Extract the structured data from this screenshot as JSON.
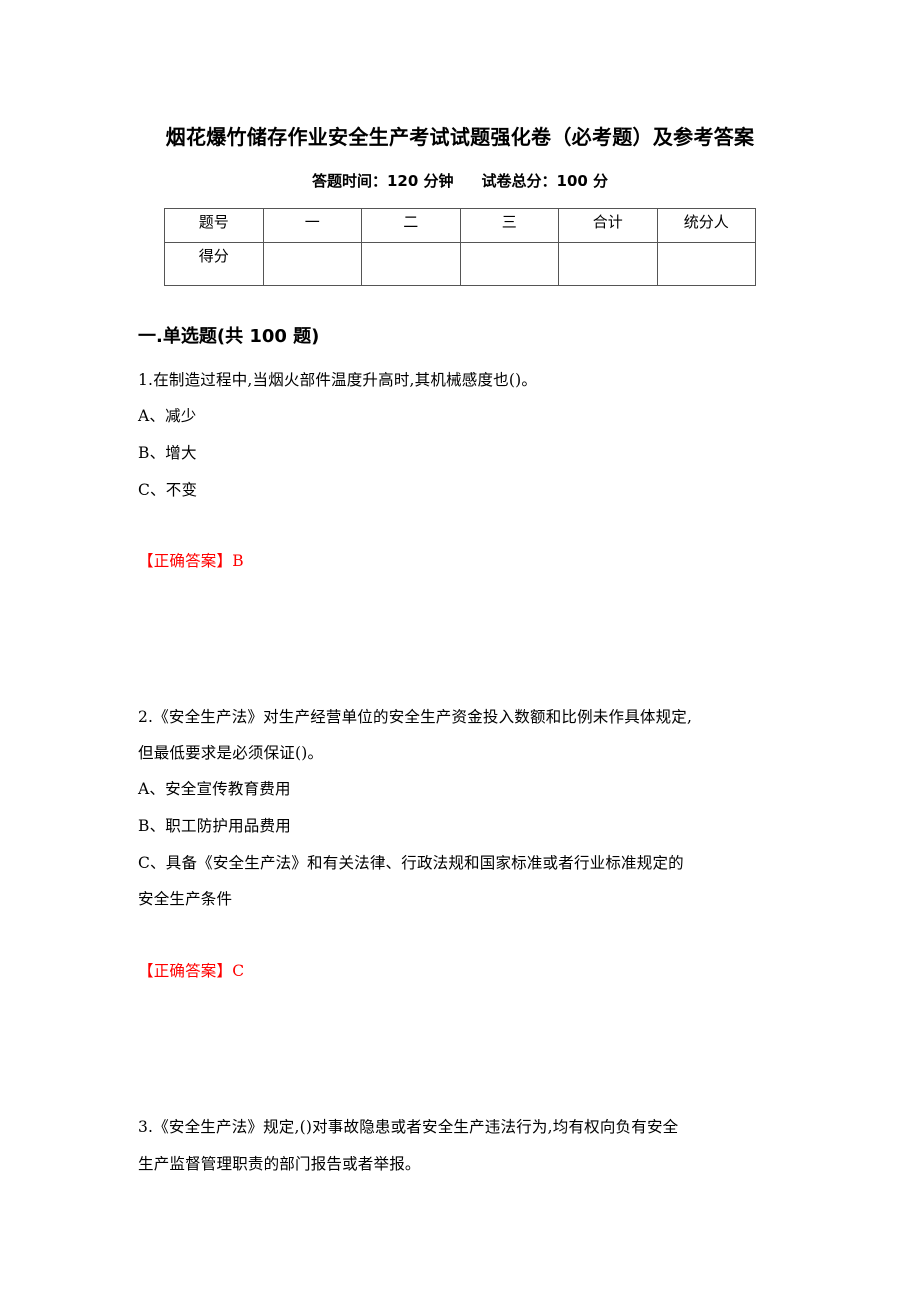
{
  "document": {
    "title": "烟花爆竹储存作业安全生产考试试题强化卷（必考题）及参考答案",
    "time_label": "答题时间：120 分钟",
    "total_label": "试卷总分：100 分"
  },
  "score_table": {
    "header": [
      "题号",
      "一",
      "二",
      "三",
      "合计",
      "统分人"
    ],
    "row_label": "得分",
    "row_values": [
      "",
      "",
      "",
      "",
      ""
    ]
  },
  "section": {
    "heading": "一.单选题(共 100 题)"
  },
  "questions": [
    {
      "lines": [
        "1.在制造过程中,当烟火部件温度升高时,其机械感度也()。"
      ],
      "options": [
        "A、减少",
        "B、增大",
        "C、不变"
      ],
      "answer": "【正确答案】B"
    },
    {
      "lines": [
        "2.《安全生产法》对生产经营单位的安全生产资金投入数额和比例未作具体规定,",
        "但最低要求是必须保证()。"
      ],
      "options": [
        "A、安全宣传教育费用",
        "B、职工防护用品费用",
        "C、具备《安全生产法》和有关法律、行政法规和国家标准或者行业标准规定的",
        "安全生产条件"
      ],
      "answer": "【正确答案】C"
    },
    {
      "lines": [
        "3.《安全生产法》规定,()对事故隐患或者安全生产违法行为,均有权向负有安全",
        "生产监督管理职责的部门报告或者举报。"
      ],
      "options": [],
      "answer": ""
    }
  ]
}
